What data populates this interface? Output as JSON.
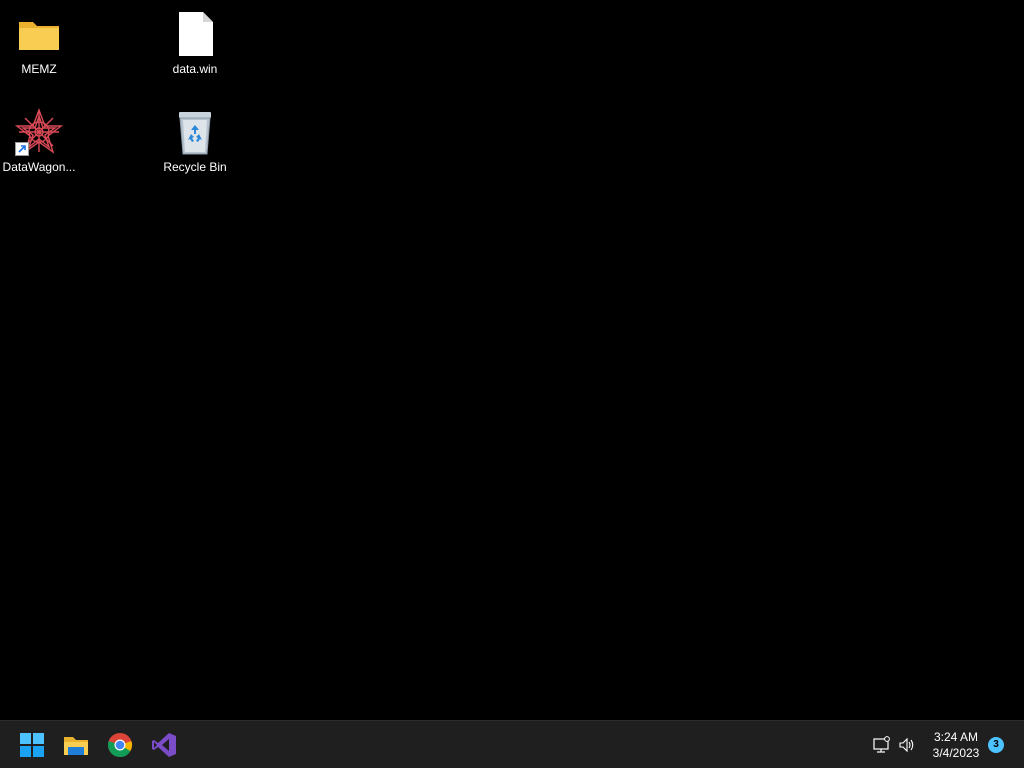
{
  "desktop": {
    "icons": [
      {
        "label": "MEMZ",
        "icon": "folder-icon"
      },
      {
        "label": "data.win",
        "icon": "file-icon"
      },
      {
        "label": "DataWagon...",
        "icon": "app-shortcut-icon"
      },
      {
        "label": "Recycle Bin",
        "icon": "recycle-bin-icon"
      }
    ]
  },
  "taskbar": {
    "pinned": [
      {
        "icon": "windows-start-icon"
      },
      {
        "icon": "file-explorer-icon"
      },
      {
        "icon": "chrome-icon"
      },
      {
        "icon": "visual-studio-icon"
      }
    ],
    "tray": {
      "icons": [
        "network-icon",
        "volume-icon"
      ],
      "time": "3:24 AM",
      "date": "3/4/2023",
      "notification_count": "3"
    }
  },
  "colors": {
    "desktop_background": "#000000",
    "taskbar_background": "#1f1f1f",
    "accent": "#4cc2ff"
  }
}
